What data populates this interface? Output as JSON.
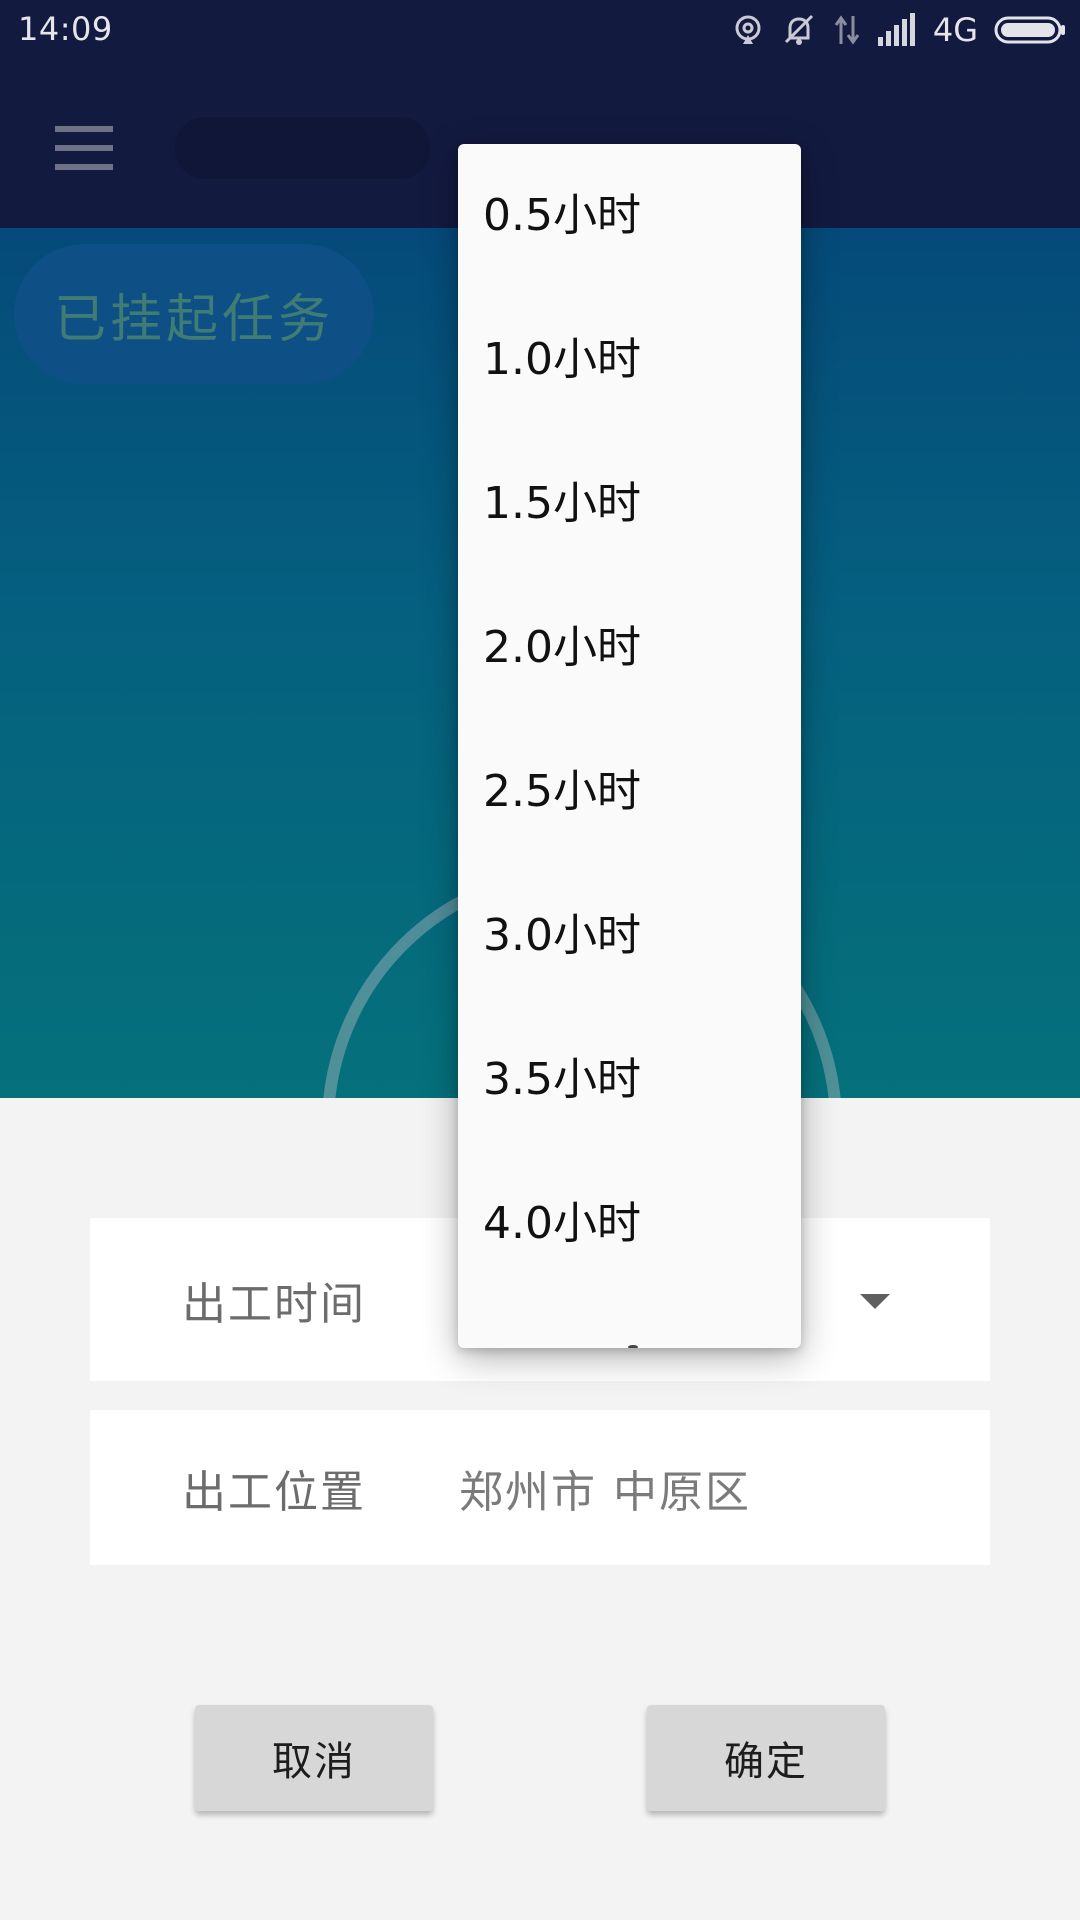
{
  "status_bar": {
    "time": "14:09",
    "network": "4G",
    "icons": [
      "hotspot-icon",
      "alarm-off-icon",
      "data-arrows-icon",
      "signal-icon",
      "battery-icon"
    ]
  },
  "toolbar": {
    "menu_icon": "hamburger-icon"
  },
  "hero": {
    "suspended_chip_label": "已挂起任务"
  },
  "form": {
    "time": {
      "label": "出工时间",
      "value": ""
    },
    "location": {
      "label": "出工位置",
      "value": "郑州市 中原区"
    }
  },
  "buttons": {
    "cancel": "取消",
    "confirm": "确定"
  },
  "dropdown": {
    "options": [
      "0.5小时",
      "1.0小时",
      "1.5小时",
      "2.0小时",
      "2.5小时",
      "3.0小时",
      "3.5小时",
      "4.0小时"
    ]
  },
  "colors": {
    "toolbar_bg": "#131a40",
    "hero_top": "#054a7a",
    "hero_bottom": "#05717b",
    "chip_bg": "#0e4f86",
    "button_bg": "#d7d7d7",
    "popup_bg": "#fafafa"
  }
}
